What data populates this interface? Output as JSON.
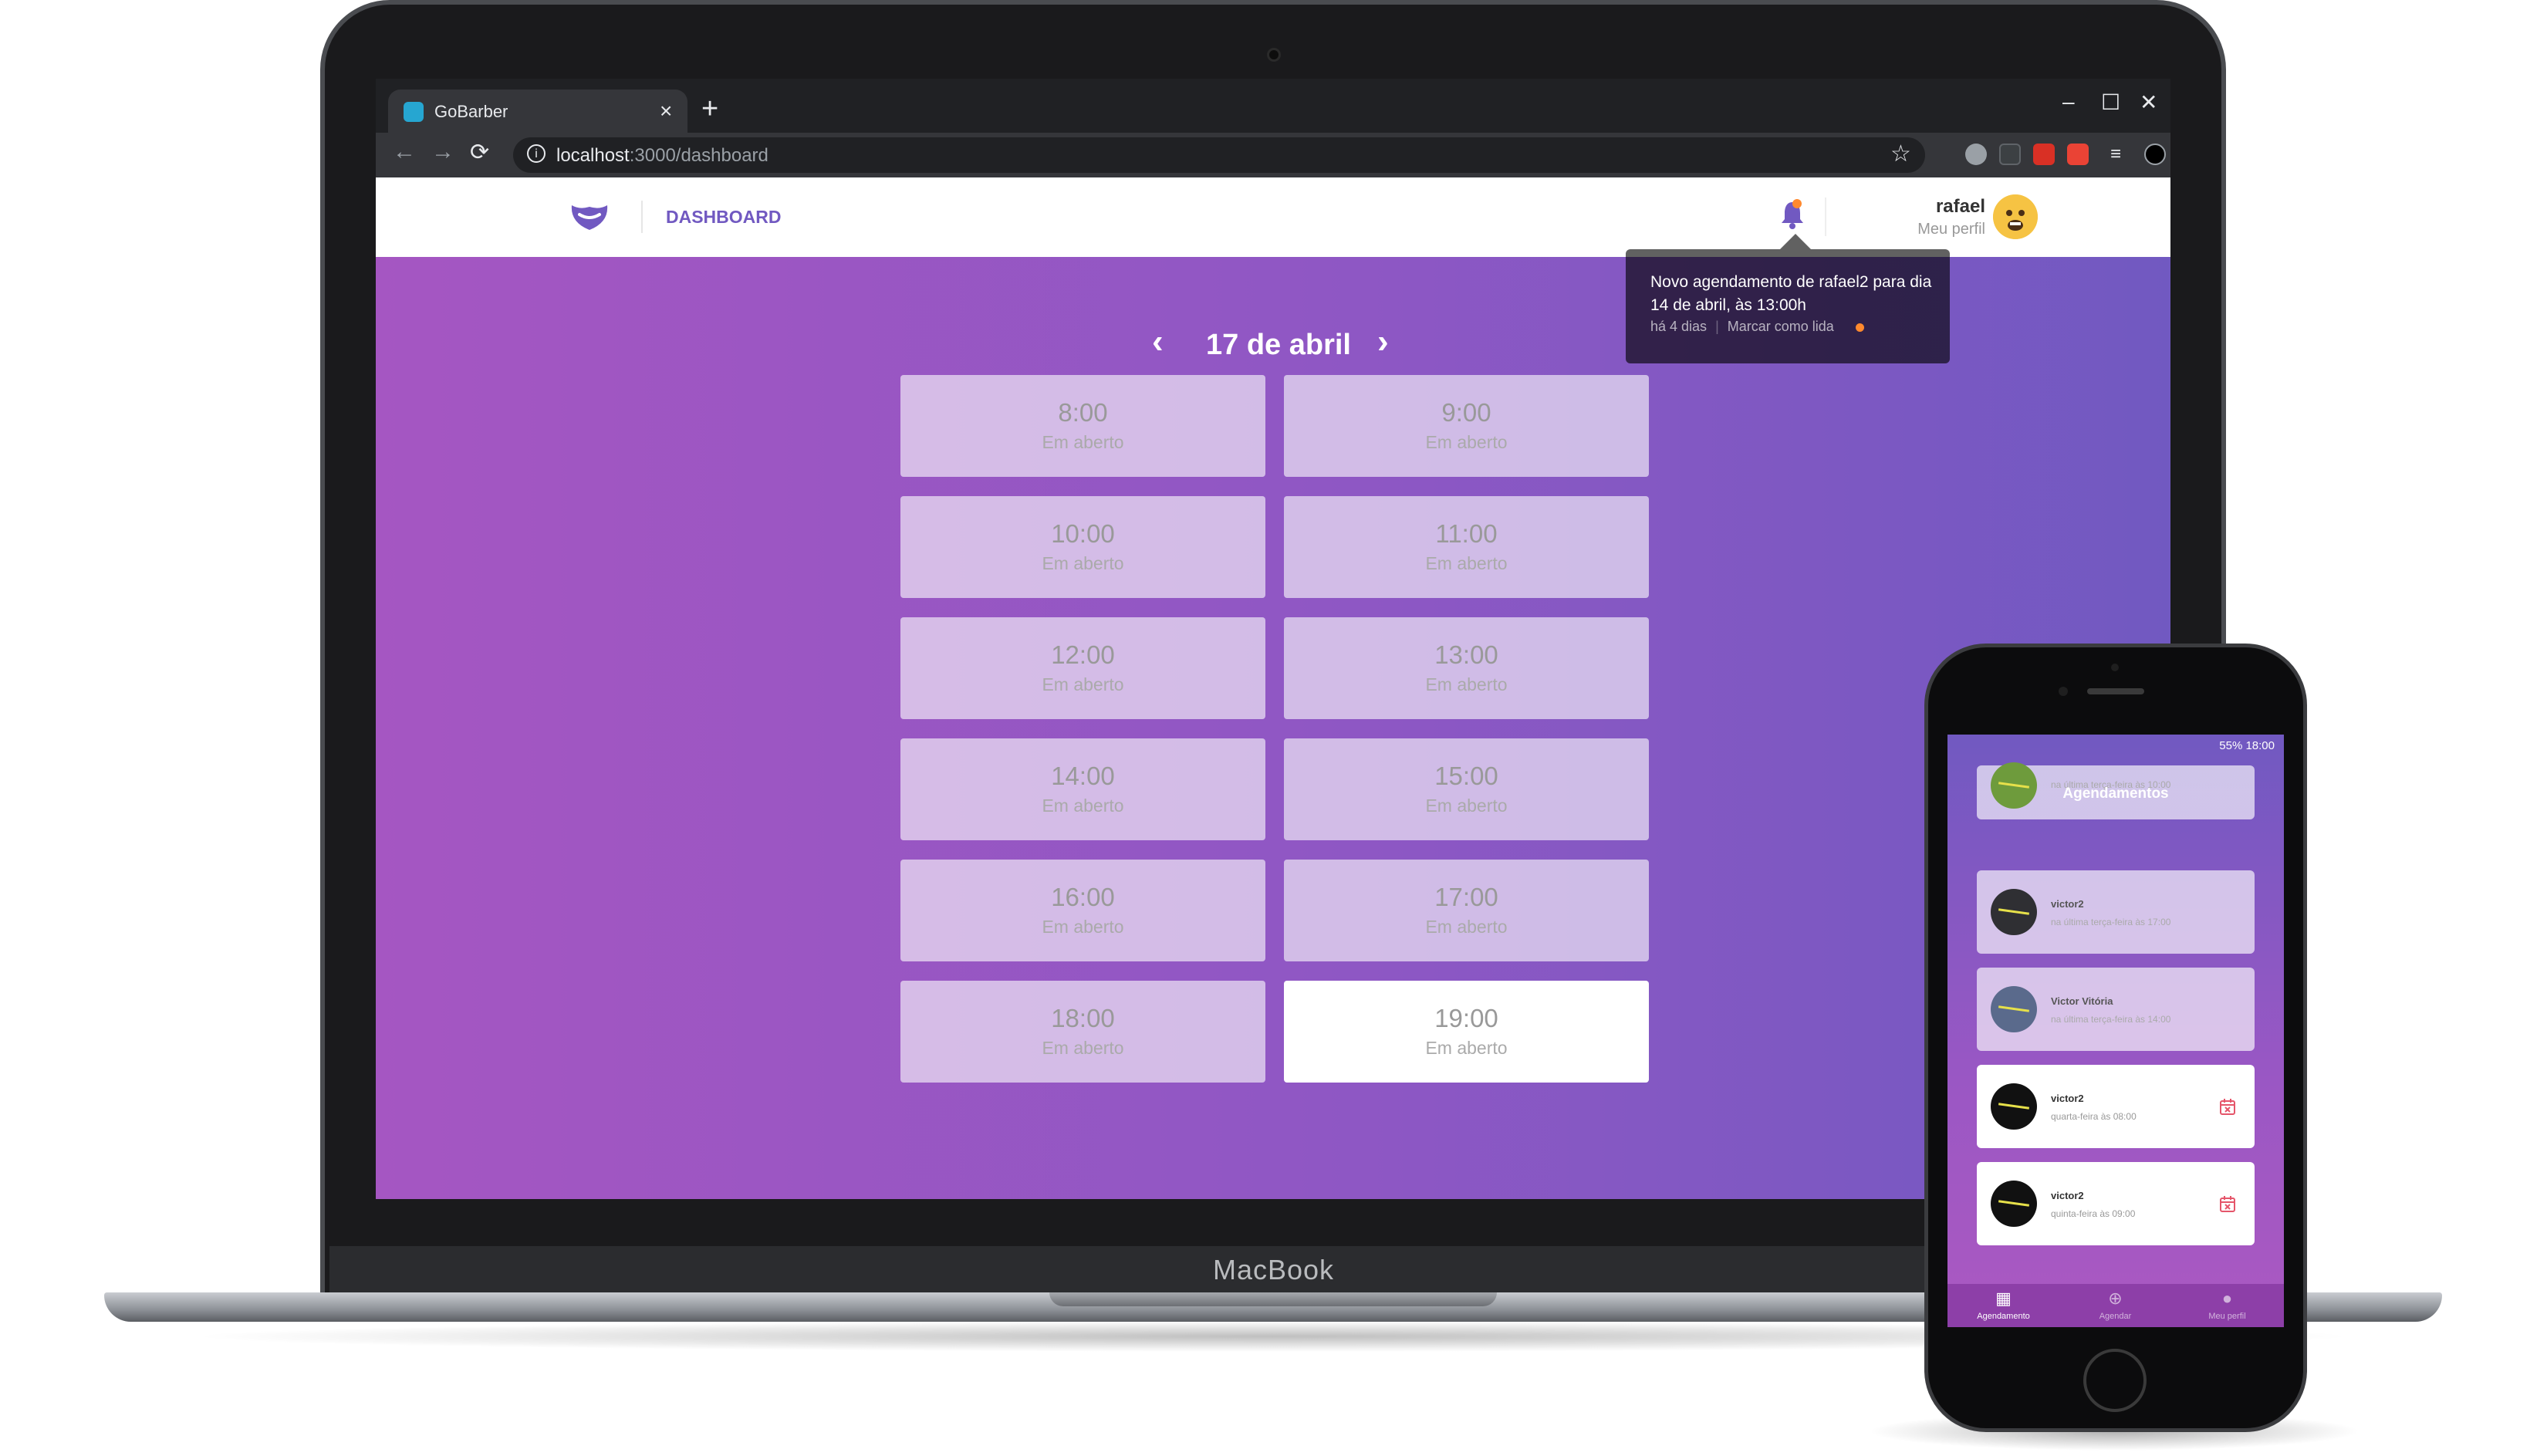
{
  "laptop": {
    "brand": "MacBook"
  },
  "browser": {
    "tab_title": "GoBarber",
    "tab_close_icon": "×",
    "new_tab_icon": "+",
    "url_host": "localhost",
    "url_path": ":3000/dashboard",
    "window_controls": {
      "minimize": "–",
      "maximize": "☐",
      "close": "✕"
    }
  },
  "header": {
    "nav_link": "DASHBOARD",
    "profile_name": "rafael",
    "profile_link": "Meu perfil"
  },
  "notification": {
    "text": "Novo agendamento de rafael2 para dia 14 de abril, às 13:00h",
    "time": "há 4 dias",
    "action": "Marcar como lida",
    "unread_color": "#ff892e"
  },
  "schedule": {
    "date": "17 de abril",
    "slots": [
      {
        "time": "8:00",
        "status": "Em aberto"
      },
      {
        "time": "9:00",
        "status": "Em aberto"
      },
      {
        "time": "10:00",
        "status": "Em aberto"
      },
      {
        "time": "11:00",
        "status": "Em aberto"
      },
      {
        "time": "12:00",
        "status": "Em aberto"
      },
      {
        "time": "13:00",
        "status": "Em aberto"
      },
      {
        "time": "14:00",
        "status": "Em aberto"
      },
      {
        "time": "15:00",
        "status": "Em aberto"
      },
      {
        "time": "16:00",
        "status": "Em aberto"
      },
      {
        "time": "17:00",
        "status": "Em aberto"
      },
      {
        "time": "18:00",
        "status": "Em aberto"
      },
      {
        "time": "19:00",
        "status": "Em aberto"
      }
    ]
  },
  "phone": {
    "status": "55% 18:00",
    "title": "Agendamentos",
    "appointments": [
      {
        "name": "",
        "date": "na última terça-feira às 10:00"
      },
      {
        "name": "victor2",
        "date": "na última terça-feira às 17:00"
      },
      {
        "name": "Victor Vitória",
        "date": "na última terça-feira às 14:00"
      },
      {
        "name": "victor2",
        "date": "quarta-feira às 08:00"
      },
      {
        "name": "victor2",
        "date": "quinta-feira às 09:00"
      }
    ],
    "tabs": [
      {
        "label": "Agendamento",
        "icon": "calendar-icon"
      },
      {
        "label": "Agendar",
        "icon": "add-circle-icon"
      },
      {
        "label": "Meu perfil",
        "icon": "person-icon"
      }
    ]
  },
  "colors": {
    "brand": "#7159c1",
    "accent": "#ff892e"
  }
}
